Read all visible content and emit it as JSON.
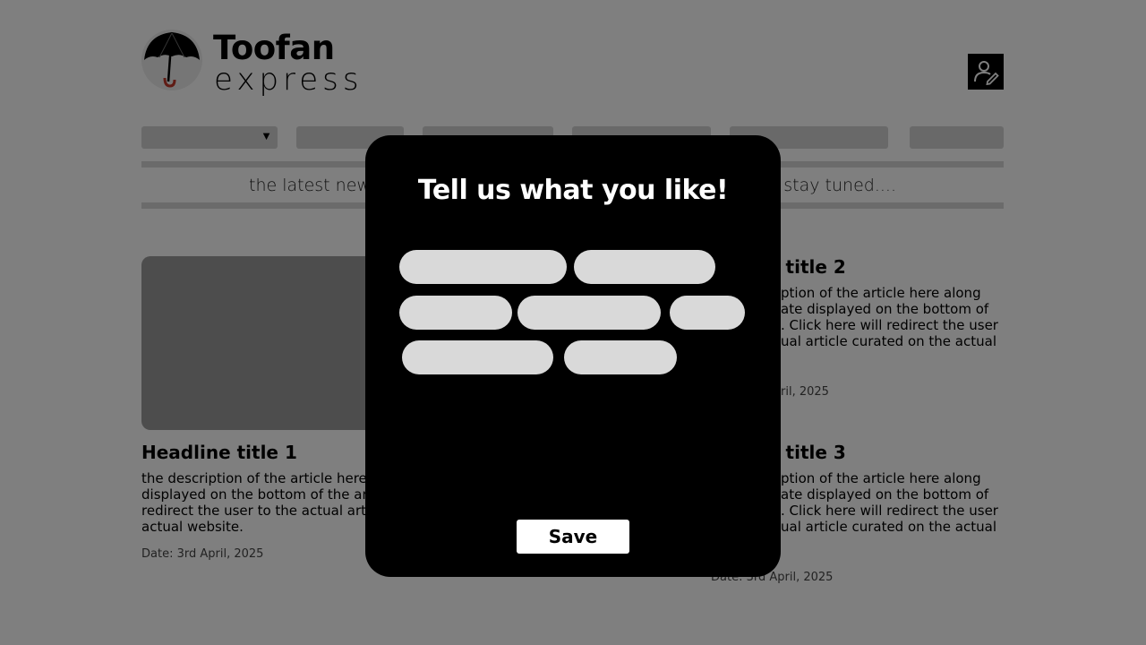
{
  "brand": {
    "name": "Toofan",
    "tagline": "express",
    "colors": {
      "accent": "#000000",
      "umbrella_handle": "#c0392b"
    }
  },
  "header": {
    "profile_icon": "user-edit-icon"
  },
  "nav": {
    "items": [
      {
        "label": "",
        "has_dropdown": true,
        "dropdown_icon": "caret-down-icon"
      },
      {
        "label": ""
      },
      {
        "label": ""
      },
      {
        "label": ""
      },
      {
        "label": ""
      },
      {
        "label": ""
      }
    ]
  },
  "ticker": {
    "left_text": "the latest new",
    "right_text": ". stay tuned...."
  },
  "articles": [
    {
      "headline": "Headline title 1",
      "description_lines": [
        "the description of the article here",
        "displayed on the bottom of the ar",
        "redirect the user to the actual arti",
        "actual website."
      ],
      "date": "Date: 3rd April, 2025"
    },
    {
      "headline": "e title 2",
      "description_lines": [
        "ption of the article here along",
        "ate displayed on the bottom of",
        ". Click here will redirect the user",
        "ual article curated on the actual"
      ],
      "date": "ril, 2025"
    },
    {
      "headline": "e title 3",
      "description_lines": [
        "ption of the article here along",
        "ate displayed on the bottom of",
        ". Click here will redirect the user",
        "ual article curated on the actual"
      ],
      "date": "Date: 3rd April, 2025"
    }
  ],
  "modal": {
    "title": "Tell us what you like!",
    "chips": [
      "",
      "",
      "",
      "",
      "",
      "",
      ""
    ],
    "save_label": "Save"
  }
}
